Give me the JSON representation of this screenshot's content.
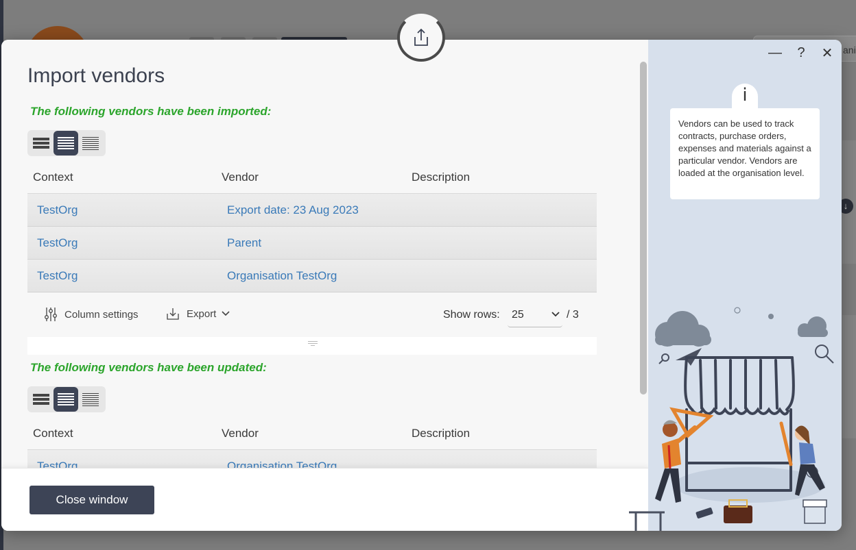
{
  "background": {
    "search_text": "ani"
  },
  "modal": {
    "title": "Import vendors",
    "imported_section": {
      "heading": "The following vendors have been imported:",
      "columns": [
        "Context",
        "Vendor",
        "Description"
      ],
      "rows": [
        {
          "context": "TestOrg",
          "vendor": "Export date: 23 Aug 2023",
          "description": ""
        },
        {
          "context": "TestOrg",
          "vendor": "Parent",
          "description": ""
        },
        {
          "context": "TestOrg",
          "vendor": "Organisation TestOrg",
          "description": ""
        }
      ],
      "footer": {
        "column_settings": "Column settings",
        "export": "Export",
        "show_rows_label": "Show rows:",
        "rows_per_page": "25",
        "total": "/ 3"
      }
    },
    "updated_section": {
      "heading": "The following vendors have been updated:",
      "columns": [
        "Context",
        "Vendor",
        "Description"
      ],
      "rows": [
        {
          "context": "TestOrg",
          "vendor": "Organisation TestOrg",
          "description": ""
        }
      ]
    },
    "close_button": "Close window"
  },
  "side_panel": {
    "controls": {
      "minimize": "—",
      "help": "?",
      "close": "✕"
    },
    "info_icon": "i",
    "info_text": "Vendors can be used to track contracts, purchase orders, expenses and materials against a particular vendor. Vendors are loaded at the organisation level."
  },
  "icons": {
    "upload": "upload-icon",
    "density_compact": "density-compact-icon",
    "density_normal": "density-normal-icon",
    "density_dense": "density-dense-icon",
    "column_settings": "sliders-icon",
    "export": "download-icon",
    "chevron": "chevron-down-icon"
  },
  "colors": {
    "accent_dark": "#3d4456",
    "success_green": "#2ca52c",
    "link_blue": "#3a7ab8",
    "panel_bg": "#d7e0ec"
  }
}
